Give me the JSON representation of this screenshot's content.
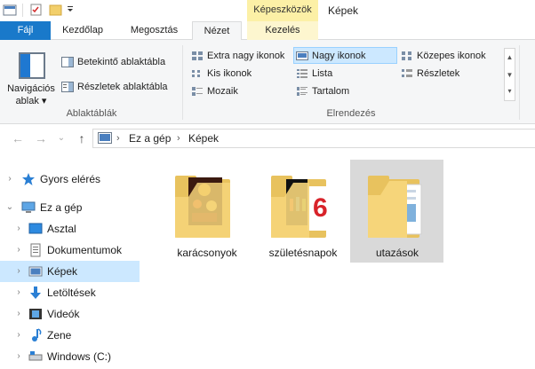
{
  "window": {
    "title": "Képek",
    "context_tab_header": "Képeszközök"
  },
  "tabs": {
    "file": "Fájl",
    "home": "Kezdőlap",
    "share": "Megosztás",
    "view": "Nézet",
    "manage": "Kezelés"
  },
  "ribbon": {
    "panes": {
      "navigation_pane": "Navigációs ablak",
      "preview_pane": "Betekintő ablaktábla",
      "details_pane": "Részletek ablaktábla",
      "group_label": "Ablaktáblák"
    },
    "layout": {
      "extra_large": "Extra nagy ikonok",
      "large": "Nagy ikonok",
      "medium": "Közepes ikonok",
      "small": "Kis ikonok",
      "list": "Lista",
      "details": "Részletek",
      "tiles": "Mozaik",
      "content": "Tartalom",
      "group_label": "Elrendezés",
      "selected": "large"
    }
  },
  "address": {
    "crumbs": [
      "Ez a gép",
      "Képek"
    ]
  },
  "navpane": {
    "items": [
      {
        "label": "Gyors elérés",
        "icon": "star-icon"
      },
      {
        "label": "Ez a gép",
        "icon": "computer-icon"
      },
      {
        "label": "Asztal",
        "icon": "desktop-icon"
      },
      {
        "label": "Dokumentumok",
        "icon": "documents-icon"
      },
      {
        "label": "Képek",
        "icon": "pictures-icon",
        "selected": true
      },
      {
        "label": "Letöltések",
        "icon": "downloads-icon"
      },
      {
        "label": "Videók",
        "icon": "videos-icon"
      },
      {
        "label": "Zene",
        "icon": "music-icon"
      },
      {
        "label": "Windows (C:)",
        "icon": "drive-icon"
      }
    ]
  },
  "folders": [
    {
      "name": "karácsonyok"
    },
    {
      "name": "születésnapok"
    },
    {
      "name": "utazások",
      "selected": true
    }
  ],
  "colors": {
    "accent": "#1979ca",
    "selection": "#cce8ff",
    "context_tab": "#fcf0a6",
    "folder": "#f6d57a"
  }
}
